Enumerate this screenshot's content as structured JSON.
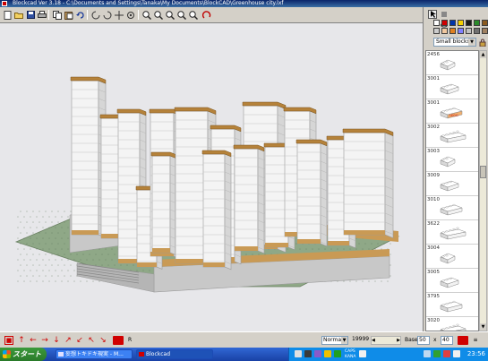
{
  "window": {
    "title": "Blockcad  Ver 3.18  -  C:\\Documents and Settings\\Tanaka\\My Documents\\BlockCAD\\Greenhouse city.lxf"
  },
  "toolbar": {
    "icons": [
      "new-icon",
      "open-icon",
      "save-icon",
      "print-icon",
      "copy-icon",
      "paste-icon",
      "undo-icon",
      "rotate-left-icon",
      "rotate-right-icon",
      "move-icon",
      "view-icon",
      "zoom-in-icon",
      "zoom-out-icon",
      "zoom-fit-icon",
      "zoom-area-icon",
      "redraw-icon"
    ]
  },
  "palette": {
    "colors": [
      "#ffffff",
      "#d00000",
      "#0033aa",
      "#f5d000",
      "#1a1a1a",
      "#2a8a2a",
      "#8a5a20",
      "#cccccc",
      "#f0c8a0",
      "#e08020",
      "#8080ff",
      "#c0c0c0",
      "#707070",
      "#a08060"
    ],
    "category": "Small blocks"
  },
  "parts": [
    {
      "id": "2456",
      "color": "#f2f2f2"
    },
    {
      "id": "3001",
      "color": "#f2f2f2"
    },
    {
      "id": "3001",
      "color": "#f0b070",
      "label": "LEGO"
    },
    {
      "id": "3002",
      "color": "#f2f2f2"
    },
    {
      "id": "3003",
      "color": "#f2f2f2"
    },
    {
      "id": "3009",
      "color": "#f2f2f2"
    },
    {
      "id": "3010",
      "color": "#f2f2f2"
    },
    {
      "id": "3622",
      "color": "#f2f2f2"
    },
    {
      "id": "3004",
      "color": "#f2f2f2"
    },
    {
      "id": "3005",
      "color": "#f2f2f2"
    },
    {
      "id": "3795",
      "color": "#f2f2f2"
    },
    {
      "id": "3020",
      "color": "#f2f2f2"
    }
  ],
  "scene": {
    "colors": {
      "base_plate": "#8fa887",
      "wall": "#c8c8c8",
      "brick_face": "#f4f4f4",
      "brick_side": "#d6d6d6",
      "roof_cap": "#b5823a",
      "floor_band": "#c99a55"
    }
  },
  "statusbar": {
    "mode": "Norma",
    "count": "19999",
    "base_label": "Base",
    "base_x": "50",
    "base_y": "40",
    "x_label": "x",
    "r_label": "R"
  },
  "taskbar": {
    "start_label": "スタート",
    "tasks": [
      {
        "label": "妄想トキドキ現実 - M...",
        "active": false
      },
      {
        "label": "Blockcad",
        "active": true
      }
    ],
    "tray_labels": [
      "CAPS",
      "KANA"
    ],
    "clock": "23:56"
  }
}
